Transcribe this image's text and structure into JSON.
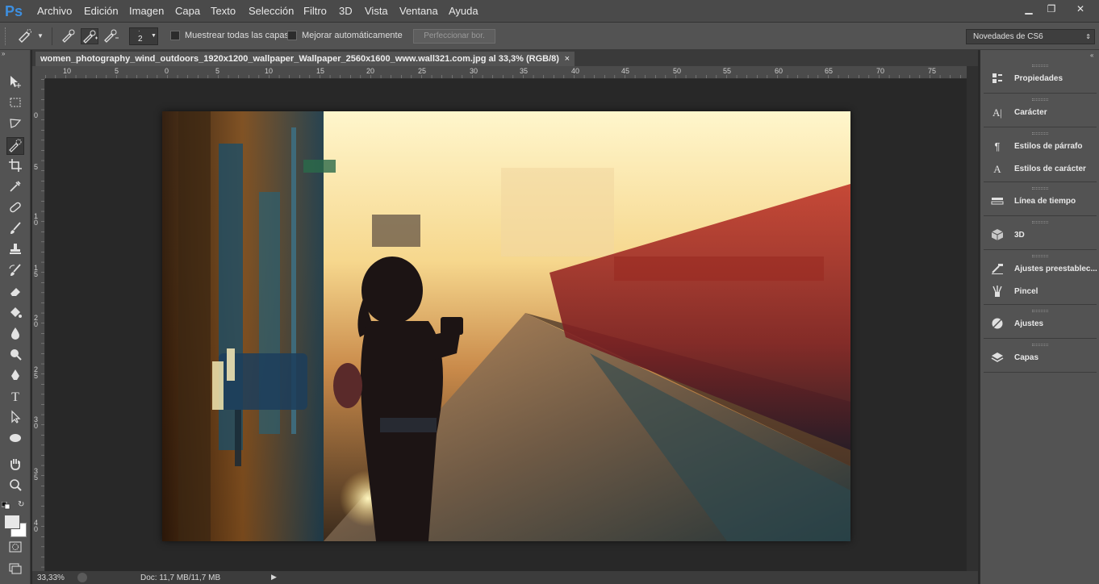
{
  "app": {
    "logo": "Ps"
  },
  "menubar": {
    "items": [
      "Archivo",
      "Edición",
      "Imagen",
      "Capa",
      "Texto",
      "Selección",
      "Filtro",
      "3D",
      "Vista",
      "Ventana",
      "Ayuda"
    ],
    "window_controls": {
      "minimize": "▁",
      "restore": "❐",
      "close": "✕"
    }
  },
  "options_bar": {
    "brush_size": "2",
    "sample_all_layers_label": "Muestrear todas las capas",
    "auto_enhance_label": "Mejorar automáticamente",
    "refine_edge_label": "Perfeccionar bor.",
    "workspace_label": "Novedades de CS6"
  },
  "toolbar": {
    "tools": [
      "move",
      "marquee",
      "lasso",
      "quick-selection",
      "crop",
      "eyedropper",
      "spot-healing",
      "brush",
      "clone-stamp",
      "history-brush",
      "eraser",
      "paint-bucket",
      "blur",
      "dodge",
      "pen",
      "type",
      "path-selection",
      "ellipse",
      "hand",
      "zoom"
    ]
  },
  "document": {
    "tab_title": "women_photography_wind_outdoors_1920x1200_wallpaper_Wallpaper_2560x1600_www.wall321.com.jpg al 33,3% (RGB/8)",
    "tab_close": "×",
    "zoom": "33,33%",
    "doc_size": "Doc: 11,7 MB/11,7 MB"
  },
  "rulers": {
    "horizontal": [
      "10",
      "5",
      "0",
      "5",
      "10",
      "15",
      "20",
      "25",
      "30",
      "35",
      "40",
      "45",
      "50",
      "55",
      "60",
      "65",
      "70",
      "75"
    ],
    "vertical": [
      "0",
      "5",
      "1 0",
      "1 5",
      "2 0",
      "2 5",
      "3 0",
      "3 5",
      "4 0"
    ]
  },
  "panels": {
    "groups": [
      [
        {
          "label": "Propiedades",
          "icon": "properties-icon"
        }
      ],
      [
        {
          "label": "Carácter",
          "icon": "character-icon"
        }
      ],
      [
        {
          "label": "Estilos de párrafo",
          "icon": "paragraph-styles-icon"
        },
        {
          "label": "Estilos de carácter",
          "icon": "character-styles-icon"
        }
      ],
      [
        {
          "label": "Línea de tiempo",
          "icon": "timeline-icon"
        }
      ],
      [
        {
          "label": "3D",
          "icon": "cube-icon"
        }
      ],
      [
        {
          "label": "Ajustes preestablec...",
          "icon": "tool-presets-icon"
        },
        {
          "label": "Pincel",
          "icon": "brush-icon"
        }
      ],
      [
        {
          "label": "Ajustes",
          "icon": "adjustments-icon"
        }
      ],
      [
        {
          "label": "Capas",
          "icon": "layers-icon"
        }
      ]
    ]
  }
}
